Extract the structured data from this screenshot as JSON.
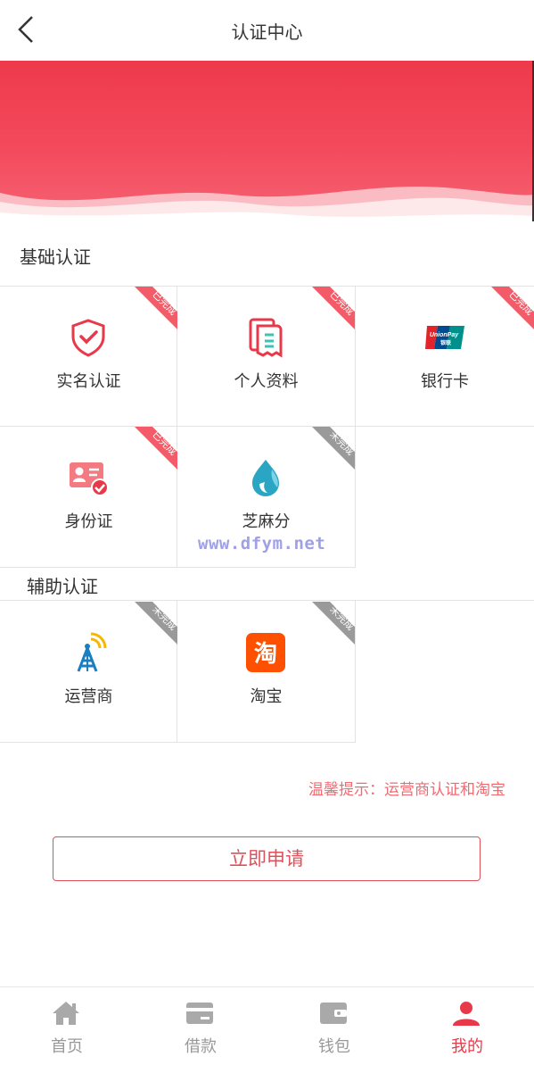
{
  "header": {
    "title": "认证中心"
  },
  "sections": {
    "basic": "基础认证",
    "auxiliary": "辅助认证"
  },
  "basic_items": [
    {
      "label": "实名认证",
      "status": "已完成",
      "icon": "shield-check-icon"
    },
    {
      "label": "个人资料",
      "status": "已完成",
      "icon": "document-icon"
    },
    {
      "label": "银行卡",
      "status": "已完成",
      "icon": "unionpay-icon"
    },
    {
      "label": "身份证",
      "status": "已完成",
      "icon": "id-card-icon"
    },
    {
      "label": "芝麻分",
      "status": "未完成",
      "icon": "sesame-drop-icon"
    }
  ],
  "auxiliary_items": [
    {
      "label": "运营商",
      "status": "未完成",
      "icon": "signal-tower-icon"
    },
    {
      "label": "淘宝",
      "status": "未完成",
      "icon": "taobao-icon"
    }
  ],
  "watermark": "www.dfym.net",
  "notice": "温馨提示：运营商认证和淘宝",
  "apply_button": "立即申请",
  "tabbar": [
    {
      "label": "首页",
      "icon": "home-icon",
      "active": false
    },
    {
      "label": "借款",
      "icon": "card-icon",
      "active": false
    },
    {
      "label": "钱包",
      "icon": "wallet-icon",
      "active": false
    },
    {
      "label": "我的",
      "icon": "user-icon",
      "active": true
    }
  ],
  "colors": {
    "accent": "#e8394a",
    "done_ribbon": "#f25b67",
    "todo_ribbon": "#9a9a9a",
    "inactive_tab": "#999999"
  }
}
